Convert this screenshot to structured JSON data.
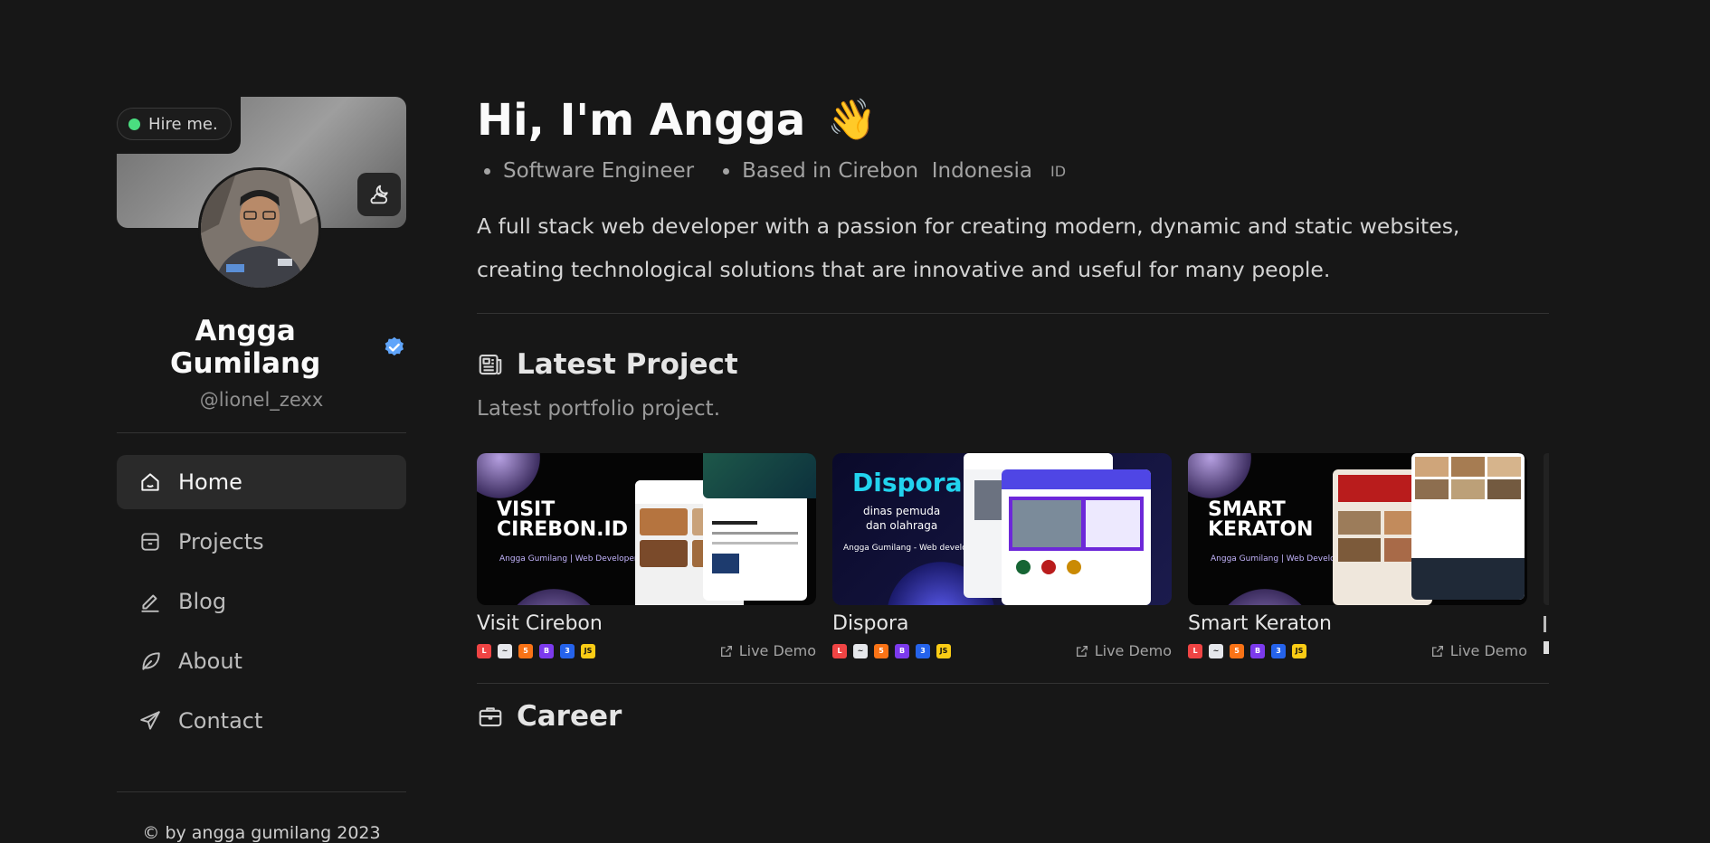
{
  "sidebar": {
    "hire_label": "Hire me.",
    "name": "Angga Gumilang",
    "handle": "@lionel_zexx",
    "nav": [
      {
        "label": "Home",
        "icon": "home-icon",
        "active": true
      },
      {
        "label": "Projects",
        "icon": "archive-icon",
        "active": false
      },
      {
        "label": "Blog",
        "icon": "pencil-icon",
        "active": false
      },
      {
        "label": "About",
        "icon": "leaf-icon",
        "active": false
      },
      {
        "label": "Contact",
        "icon": "send-icon",
        "active": false
      }
    ],
    "copyright": "© by angga gumilang 2023"
  },
  "hero": {
    "title": "Hi, I'm Angga",
    "wave": "👋",
    "role": "Software Engineer",
    "location": "Based in Cirebon  Indonesia",
    "flag": "ID",
    "bio": "A full stack web developer with a passion for creating modern, dynamic and static websites, creating technological solutions that are innovative and useful for many people."
  },
  "latest": {
    "title": "Latest Project",
    "subtitle": "Latest portfolio project.",
    "live_label": "Live Demo",
    "projects": [
      {
        "title": "Visit Cirebon",
        "thumb_big": "VISIT\nCIREBON.ID",
        "thumb_small": "Angga Gumilang | Web Developer"
      },
      {
        "title": "Dispora",
        "thumb_big": "Dispora",
        "thumb_sub": "dinas pemuda\ndan olahraga",
        "thumb_small": "Angga Gumilang - Web development"
      },
      {
        "title": "Smart Keraton",
        "thumb_big": "SMART\nKERATON",
        "thumb_small": "Angga Gumilang | Web Developer"
      }
    ]
  },
  "career": {
    "title": "Career"
  },
  "colors": {
    "bg": "#171717",
    "accent_green": "#4ade80",
    "verified_blue": "#60a5fa"
  }
}
